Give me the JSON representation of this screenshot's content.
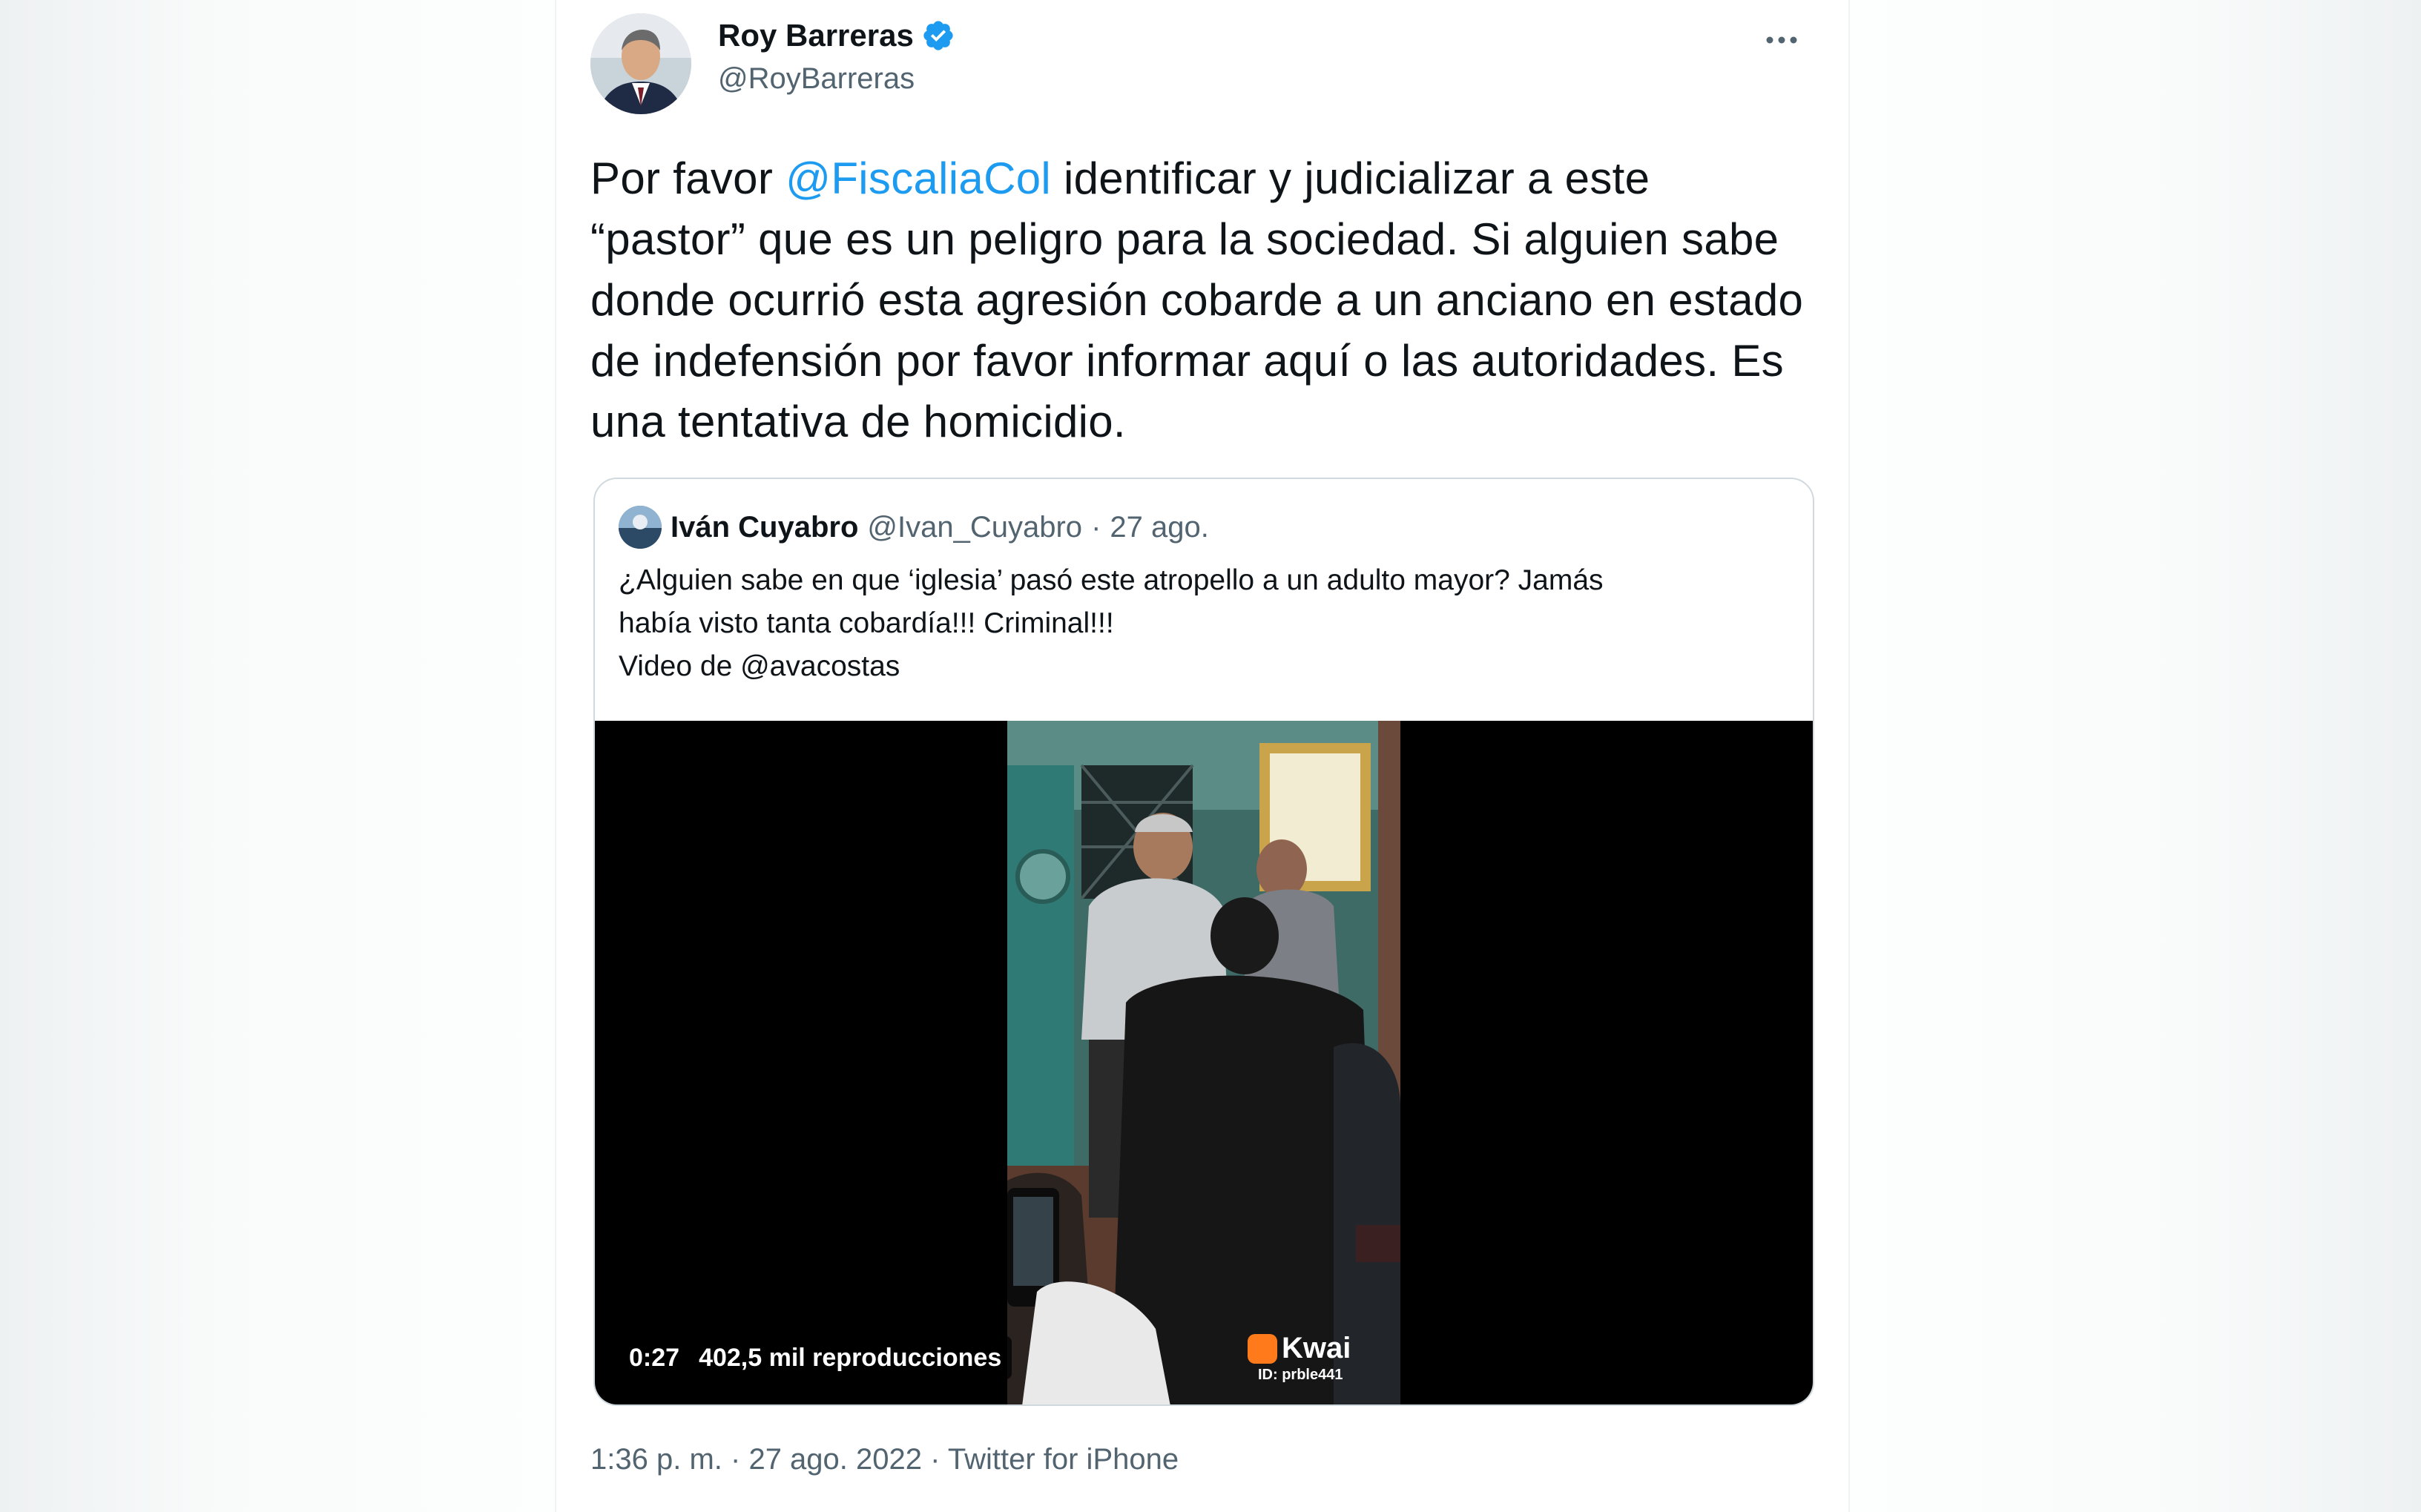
{
  "tweet": {
    "author": {
      "name": "Roy Barreras",
      "handle": "@RoyBarreras",
      "verified_icon": "verified-badge-icon",
      "avatar": "avatar"
    },
    "text": {
      "part1": "Por favor ",
      "mention": "@FiscaliaCol",
      "part2": " identificar y judicializar a este “pastor” que es un peligro para  la sociedad. Si alguien sabe donde ocurrió esta agresión cobarde a un anciano en estado de indefensión por favor informar aquí o las autoridades. Es una tentativa de homicidio."
    },
    "footer": {
      "time": "1:36 p. m.",
      "date": "27 ago. 2022",
      "source": "Twitter for iPhone",
      "separator": "·"
    }
  },
  "quoted": {
    "name": "Iván Cuyabro",
    "handle": "@Ivan_Cuyabro",
    "separator": "·",
    "date": "27 ago.",
    "lines": [
      "¿Alguien sabe en que ‘iglesia’ pasó este atropello a un adulto mayor? Jamás",
      "había visto tanta cobardía!!! Criminal!!!",
      "Video de @avacostas"
    ],
    "video": {
      "duration": "0:27",
      "views": "402,5 mil reproducciones",
      "watermark": "Kwai",
      "watermark_id": "ID: prble441"
    }
  },
  "colors": {
    "text": "#0f1419",
    "secondary": "#536471",
    "link": "#1d9bf0",
    "verified": "#1d9bf0",
    "border": "#cfd9de"
  }
}
